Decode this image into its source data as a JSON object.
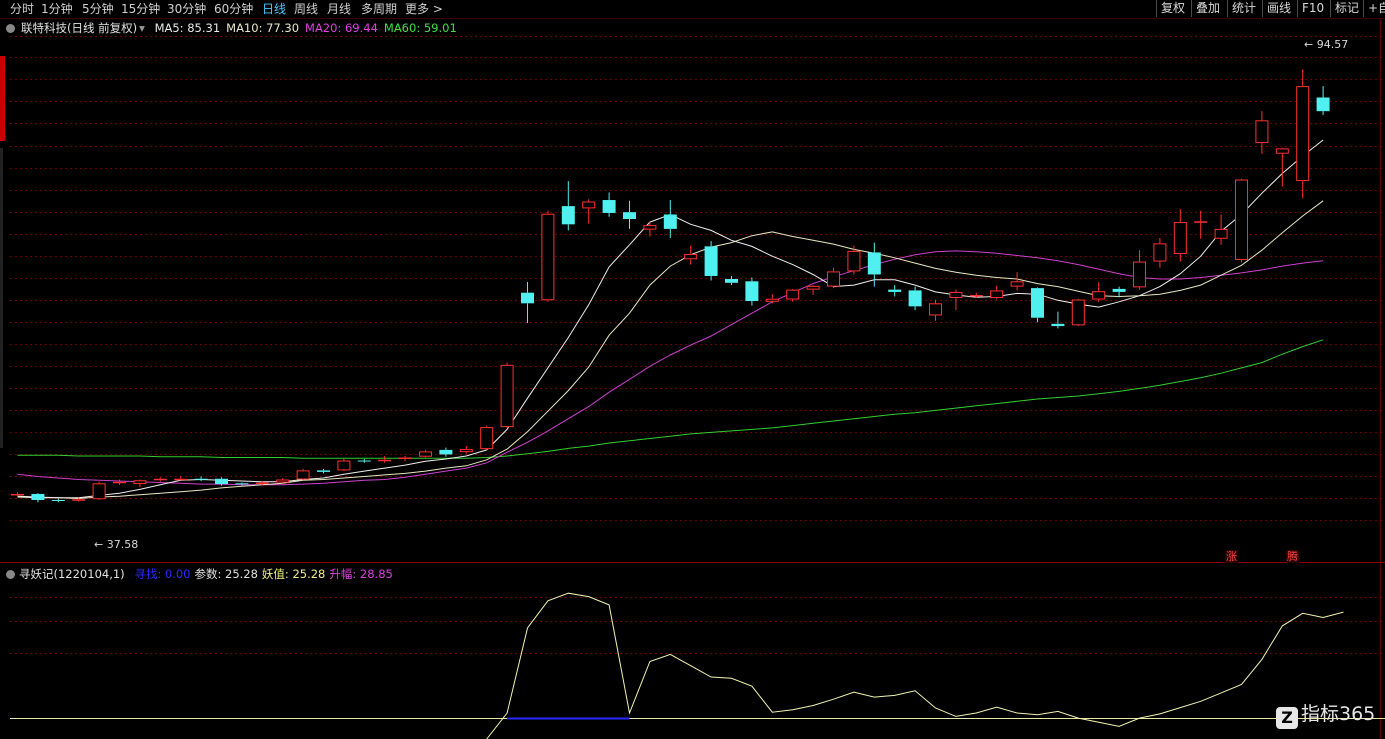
{
  "periods": [
    {
      "label": "分时",
      "active": false
    },
    {
      "label": "1分钟",
      "active": false
    },
    {
      "label": "5分钟",
      "active": false
    },
    {
      "label": "15分钟",
      "active": false
    },
    {
      "label": "30分钟",
      "active": false
    },
    {
      "label": "60分钟",
      "active": false
    },
    {
      "label": "日线",
      "active": true
    },
    {
      "label": "周线",
      "active": false
    },
    {
      "label": "月线",
      "active": false
    },
    {
      "label": "多周期",
      "active": false
    },
    {
      "label": "更多 >",
      "active": false
    }
  ],
  "toolbar_right": [
    "复权",
    "叠加",
    "统计",
    "画线",
    "F10",
    "标记",
    "+自"
  ],
  "stock_title": "联特科技(日线 前复权)",
  "ma_legend": [
    {
      "label": "MA5: 85.31",
      "color": "#e8e8e8"
    },
    {
      "label": "MA10: 77.30",
      "color": "#e8e8c8"
    },
    {
      "label": "MA20: 69.44",
      "color": "#e040e0"
    },
    {
      "label": "MA60: 59.01",
      "color": "#40e040"
    }
  ],
  "price_high_label": "94.57",
  "price_low_label": "37.58",
  "tags": [
    "涨",
    "腾"
  ],
  "indicator": {
    "name": "寻妖记(1220104,1)",
    "items": [
      {
        "label": "寻找: 0.00",
        "color": "#2a2aff"
      },
      {
        "label": "参数: 25.28",
        "color": "#e0e0e0"
      },
      {
        "label": "妖值: 25.28",
        "color": "#f0f080"
      },
      {
        "label": "升幅: 28.85",
        "color": "#e040e0"
      }
    ]
  },
  "watermark": "指标365",
  "colors": {
    "up": "#ff3030",
    "down": "#50f0f0",
    "grid": "#6a0000"
  },
  "chart_data": {
    "type": "candlestick",
    "price_range": [
      30,
      99
    ],
    "candles": [
      [
        38.6,
        38.9,
        38.3,
        38.7
      ],
      [
        38.7,
        38.8,
        37.6,
        37.9
      ],
      [
        37.9,
        38.1,
        37.6,
        37.8
      ],
      [
        37.9,
        38.2,
        37.7,
        38.0
      ],
      [
        38.0,
        40.3,
        37.9,
        40.1
      ],
      [
        40.1,
        40.6,
        39.9,
        40.3
      ],
      [
        40.0,
        40.6,
        39.6,
        40.5
      ],
      [
        40.5,
        40.9,
        40.3,
        40.7
      ],
      [
        40.7,
        41.0,
        40.5,
        40.7
      ],
      [
        40.7,
        41.0,
        40.4,
        40.6
      ],
      [
        40.7,
        40.9,
        39.8,
        40.0
      ],
      [
        40.1,
        40.2,
        39.8,
        40.0
      ],
      [
        40.0,
        40.4,
        39.8,
        40.2
      ],
      [
        40.2,
        40.8,
        40.1,
        40.6
      ],
      [
        40.6,
        42.0,
        40.5,
        41.8
      ],
      [
        41.8,
        42.0,
        41.4,
        41.6
      ],
      [
        41.8,
        43.3,
        41.7,
        43.1
      ],
      [
        43.1,
        43.3,
        42.8,
        43.0
      ],
      [
        43.0,
        43.7,
        42.8,
        43.2
      ],
      [
        43.3,
        43.7,
        43.0,
        43.5
      ],
      [
        43.6,
        44.5,
        43.5,
        44.3
      ],
      [
        44.5,
        44.8,
        43.6,
        43.9
      ],
      [
        44.2,
        45.0,
        44.0,
        44.6
      ],
      [
        44.6,
        47.7,
        44.5,
        47.5
      ],
      [
        47.5,
        56.0,
        47.4,
        55.7
      ],
      [
        65.2,
        66.6,
        61.2,
        63.8
      ],
      [
        64.2,
        76.0,
        64.0,
        75.6
      ],
      [
        76.6,
        79.9,
        73.4,
        74.2
      ],
      [
        76.3,
        77.5,
        74.3,
        77.2
      ],
      [
        77.4,
        78.4,
        75.2,
        75.7
      ],
      [
        75.8,
        77.3,
        73.6,
        74.9
      ],
      [
        73.5,
        74.5,
        72.6,
        74.1
      ],
      [
        75.5,
        77.4,
        72.4,
        73.6
      ],
      [
        69.6,
        71.4,
        68.9,
        70.3
      ],
      [
        71.3,
        72.0,
        66.8,
        67.4
      ],
      [
        67.0,
        67.4,
        66.2,
        66.5
      ],
      [
        66.7,
        67.2,
        63.5,
        64.1
      ],
      [
        64.0,
        65.0,
        63.8,
        64.4
      ],
      [
        64.3,
        65.7,
        64.0,
        65.6
      ],
      [
        65.6,
        66.2,
        64.9,
        66.1
      ],
      [
        66.0,
        68.5,
        65.8,
        68.0
      ],
      [
        68.0,
        71.4,
        67.6,
        70.7
      ],
      [
        70.5,
        71.8,
        66.0,
        67.6
      ],
      [
        65.6,
        66.2,
        64.7,
        65.3
      ],
      [
        65.5,
        66.0,
        62.9,
        63.4
      ],
      [
        62.2,
        64.3,
        61.5,
        63.8
      ],
      [
        64.5,
        65.6,
        62.9,
        65.3
      ],
      [
        64.7,
        65.2,
        64.5,
        64.9
      ],
      [
        64.5,
        66.1,
        64.3,
        65.5
      ],
      [
        66.0,
        67.9,
        65.5,
        66.7
      ],
      [
        65.8,
        65.9,
        61.3,
        61.9
      ],
      [
        61.1,
        62.7,
        60.5,
        60.8
      ],
      [
        60.9,
        64.4,
        60.8,
        64.3
      ],
      [
        64.3,
        66.6,
        64.0,
        65.4
      ],
      [
        65.7,
        66.0,
        64.6,
        65.3
      ],
      [
        65.9,
        70.8,
        65.6,
        69.3
      ],
      [
        69.3,
        72.4,
        68.5,
        71.7
      ],
      [
        70.3,
        76.2,
        69.3,
        74.5
      ],
      [
        74.5,
        76.0,
        72.3,
        74.6
      ],
      [
        72.3,
        75.5,
        71.5,
        73.6
      ],
      [
        69.5,
        80.2,
        69.2,
        80.1
      ],
      [
        84.9,
        89.1,
        83.5,
        87.9
      ],
      [
        83.5,
        84.3,
        79.2,
        84.2
      ],
      [
        79.9,
        94.6,
        77.6,
        92.4
      ],
      [
        90.9,
        92.4,
        88.6,
        89.1
      ]
    ],
    "ma5": [
      38.4,
      38.3,
      38.2,
      38.2,
      38.5,
      38.8,
      39.3,
      39.9,
      40.5,
      40.6,
      40.5,
      40.4,
      40.3,
      40.3,
      40.6,
      40.8,
      41.3,
      41.7,
      42.1,
      42.5,
      43.0,
      43.3,
      43.7,
      44.5,
      47.2,
      51.3,
      55.3,
      59.3,
      63.6,
      68.6,
      71.5,
      74.5,
      75.5,
      74.2,
      73.4,
      72.1,
      71.3,
      70.0,
      68.9,
      67.6,
      66.0,
      66.2,
      66.9,
      66.9,
      66.2,
      65.3,
      64.9,
      64.6,
      64.7,
      65.1,
      65.0,
      64.2,
      63.7,
      63.3,
      64.0,
      64.8,
      66.0,
      67.7,
      70.0,
      73.3,
      75.5,
      78.3,
      80.9,
      83.2,
      85.3
    ],
    "ma10": [
      38.3,
      38.2,
      38.2,
      38.1,
      38.3,
      38.4,
      38.6,
      38.8,
      39.0,
      39.2,
      39.5,
      39.7,
      39.9,
      40.1,
      40.5,
      40.6,
      40.8,
      41.0,
      41.2,
      41.4,
      41.7,
      42.1,
      42.4,
      43.2,
      44.6,
      46.9,
      49.6,
      52.3,
      55.4,
      59.6,
      62.5,
      66.2,
      68.7,
      70.2,
      71.2,
      71.8,
      72.7,
      73.2,
      72.6,
      72.1,
      71.6,
      70.9,
      70.4,
      69.8,
      69.1,
      68.4,
      67.9,
      67.5,
      67.2,
      67.0,
      66.4,
      66.0,
      65.4,
      64.8,
      64.7,
      64.8,
      65.0,
      65.5,
      66.2,
      67.5,
      68.8,
      70.8,
      73.1,
      75.3,
      77.3
    ],
    "ma20": [
      41.3,
      41.0,
      40.8,
      40.6,
      40.5,
      40.4,
      40.3,
      40.2,
      40.1,
      40.0,
      40.0,
      39.9,
      39.9,
      39.9,
      40.0,
      40.1,
      40.3,
      40.5,
      40.6,
      40.9,
      41.3,
      41.7,
      42.1,
      42.8,
      44.2,
      45.5,
      47.0,
      48.6,
      50.2,
      52.1,
      53.8,
      55.5,
      57.0,
      58.3,
      59.5,
      61.0,
      62.5,
      64.0,
      65.2,
      66.4,
      67.3,
      68.1,
      68.9,
      69.6,
      70.2,
      70.6,
      70.7,
      70.6,
      70.4,
      70.1,
      69.8,
      69.4,
      68.9,
      68.3,
      67.7,
      67.2,
      67.0,
      67.0,
      67.2,
      67.5,
      67.8,
      68.2,
      68.7,
      69.1,
      69.4
    ],
    "ma60": [
      43.8,
      43.8,
      43.8,
      43.7,
      43.7,
      43.7,
      43.7,
      43.6,
      43.6,
      43.6,
      43.5,
      43.5,
      43.5,
      43.5,
      43.4,
      43.4,
      43.4,
      43.4,
      43.4,
      43.4,
      43.4,
      43.4,
      43.4,
      43.5,
      43.7,
      44.0,
      44.3,
      44.7,
      45.0,
      45.4,
      45.7,
      46.0,
      46.3,
      46.6,
      46.8,
      47.0,
      47.2,
      47.4,
      47.7,
      48.0,
      48.3,
      48.6,
      48.9,
      49.2,
      49.4,
      49.7,
      50.0,
      50.3,
      50.6,
      50.9,
      51.2,
      51.4,
      51.6,
      51.9,
      52.2,
      52.6,
      53.0,
      53.5,
      54.0,
      54.6,
      55.3,
      56.0,
      57.1,
      58.1,
      59.0
    ],
    "indicator_range": [
      -5,
      32
    ],
    "indicator_values": [
      null,
      null,
      null,
      null,
      null,
      null,
      null,
      null,
      null,
      null,
      null,
      null,
      null,
      null,
      null,
      null,
      null,
      null,
      null,
      null,
      null,
      null,
      null,
      -5,
      1.2,
      21.5,
      28.0,
      29.8,
      29.0,
      27.0,
      1.2,
      13.5,
      15.2,
      12.5,
      9.8,
      9.5,
      7.6,
      1.4,
      2.0,
      3.0,
      4.5,
      6.2,
      5.0,
      5.4,
      6.5,
      2.4,
      0.4,
      1.2,
      2.6,
      1.2,
      0.8,
      1.6,
      0.0,
      -1.0,
      -2.0,
      0.0,
      1.0,
      2.5,
      4.0,
      6.0,
      8.0,
      14.0,
      22.0,
      25.0,
      24.0,
      25.3
    ]
  }
}
